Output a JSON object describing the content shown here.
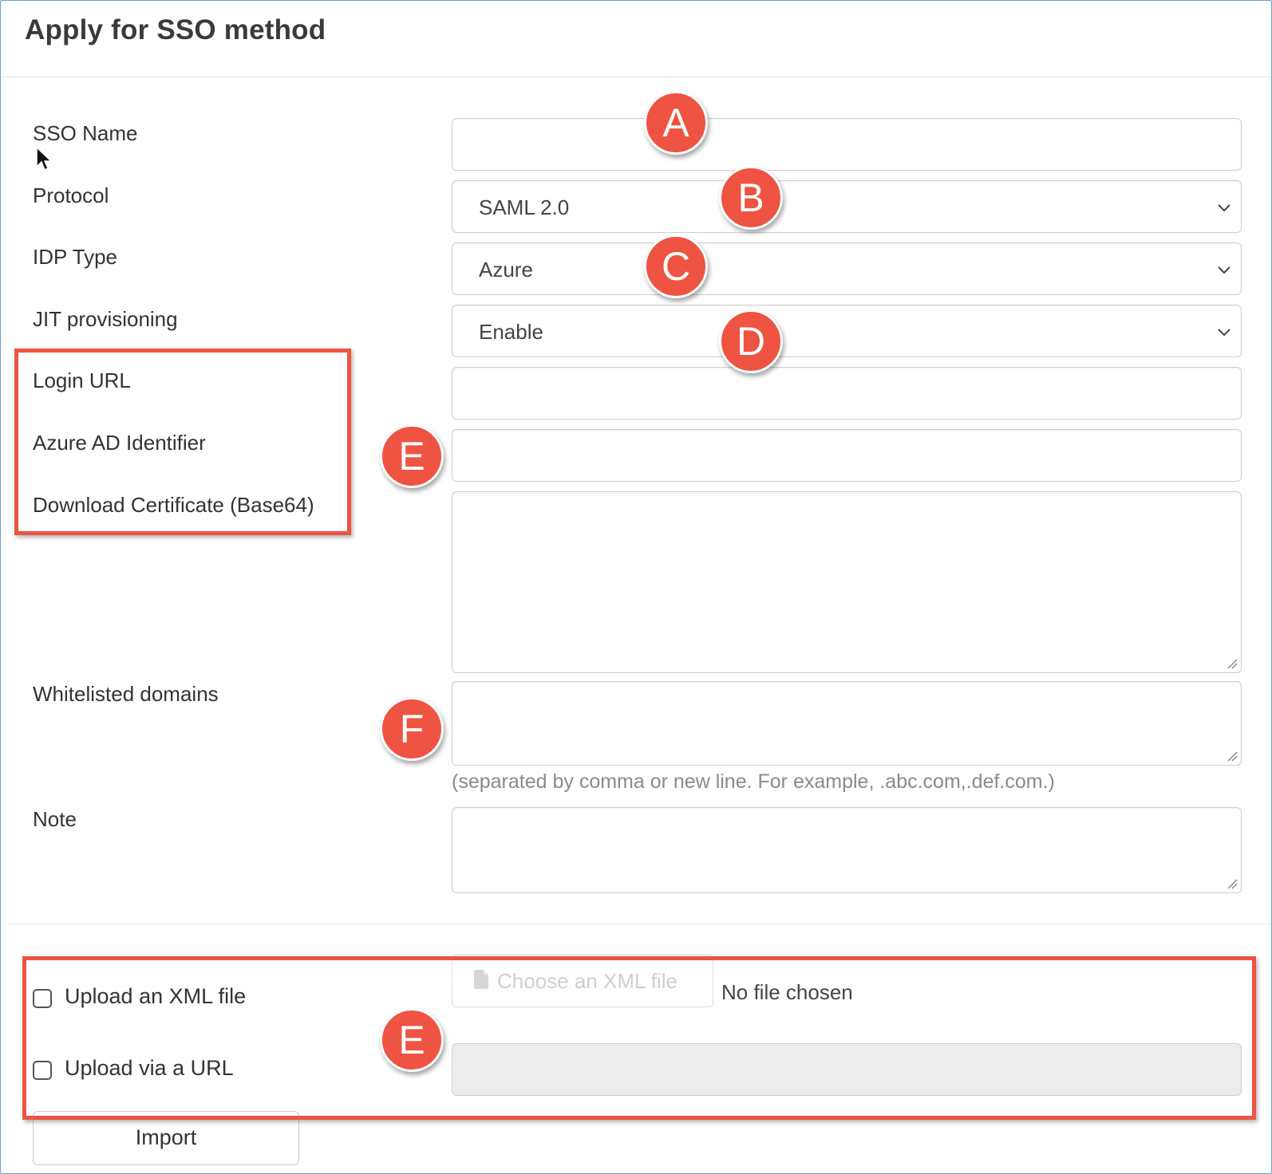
{
  "header": {
    "title": "Apply for SSO method"
  },
  "form": {
    "sso_name": {
      "label": "SSO Name",
      "value": ""
    },
    "protocol": {
      "label": "Protocol",
      "selected": "SAML 2.0"
    },
    "idp_type": {
      "label": "IDP Type",
      "selected": "Azure"
    },
    "jit": {
      "label": "JIT provisioning",
      "selected": "Enable"
    },
    "login_url": {
      "label": "Login URL",
      "value": ""
    },
    "azure_ad_identifier": {
      "label": "Azure AD Identifier",
      "value": ""
    },
    "certificate": {
      "label": "Download Certificate (Base64)",
      "value": ""
    },
    "whitelisted_domains": {
      "label": "Whitelisted domains",
      "value": "",
      "hint": "(separated by comma or new line. For example, .abc.com,.def.com.)"
    },
    "note": {
      "label": "Note",
      "value": ""
    }
  },
  "upload": {
    "xml_checkbox_label": "Upload an XML file",
    "xml_checked": false,
    "url_checkbox_label": "Upload via a URL",
    "url_checked": false,
    "choose_file_label": "Choose an XML file",
    "file_status": "No file chosen",
    "url_value": "",
    "import_label": "Import"
  },
  "callouts": {
    "a": "A",
    "b": "B",
    "c": "C",
    "d": "D",
    "e_fields": "E",
    "f": "F",
    "e_upload": "E",
    "color": "#ef5341"
  },
  "icons": {
    "select_arrow": "chevron-down-icon",
    "file": "file-icon",
    "resize": "resize-handle-icon",
    "cursor": "mouse-pointer-icon"
  }
}
